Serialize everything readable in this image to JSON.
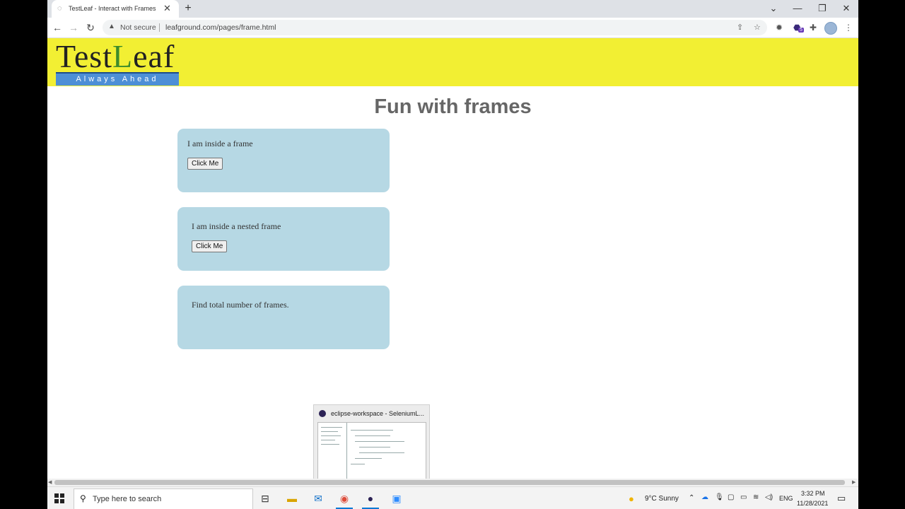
{
  "browser": {
    "tab_title": "TestLeaf - Interact with Frames",
    "tab_close": "✕",
    "new_tab": "+",
    "security_label": "Not secure",
    "url": "leafground.com/pages/frame.html",
    "extension_badge": "5"
  },
  "page": {
    "logo_main_prefix": "Test",
    "logo_leaf": "L",
    "logo_main_suffix": "eaf",
    "logo_tagline": "Always Ahead",
    "heading": "Fun with frames",
    "frames": [
      {
        "text": "I am inside a frame",
        "button_label": "Click Me"
      },
      {
        "text": "I am inside a nested frame",
        "button_label": "Click Me"
      },
      {
        "text": "Find total number of frames."
      }
    ]
  },
  "thumbnail": {
    "title": "eclipse-workspace - SeleniumL..."
  },
  "taskbar": {
    "search_placeholder": "Type here to search",
    "weather": "9°C  Sunny",
    "language": "ENG",
    "time": "3:32 PM",
    "date": "11/28/2021"
  },
  "colors": {
    "banner": "#f2ef33",
    "frame_bg": "#b6d8e4",
    "heading": "#666666"
  }
}
